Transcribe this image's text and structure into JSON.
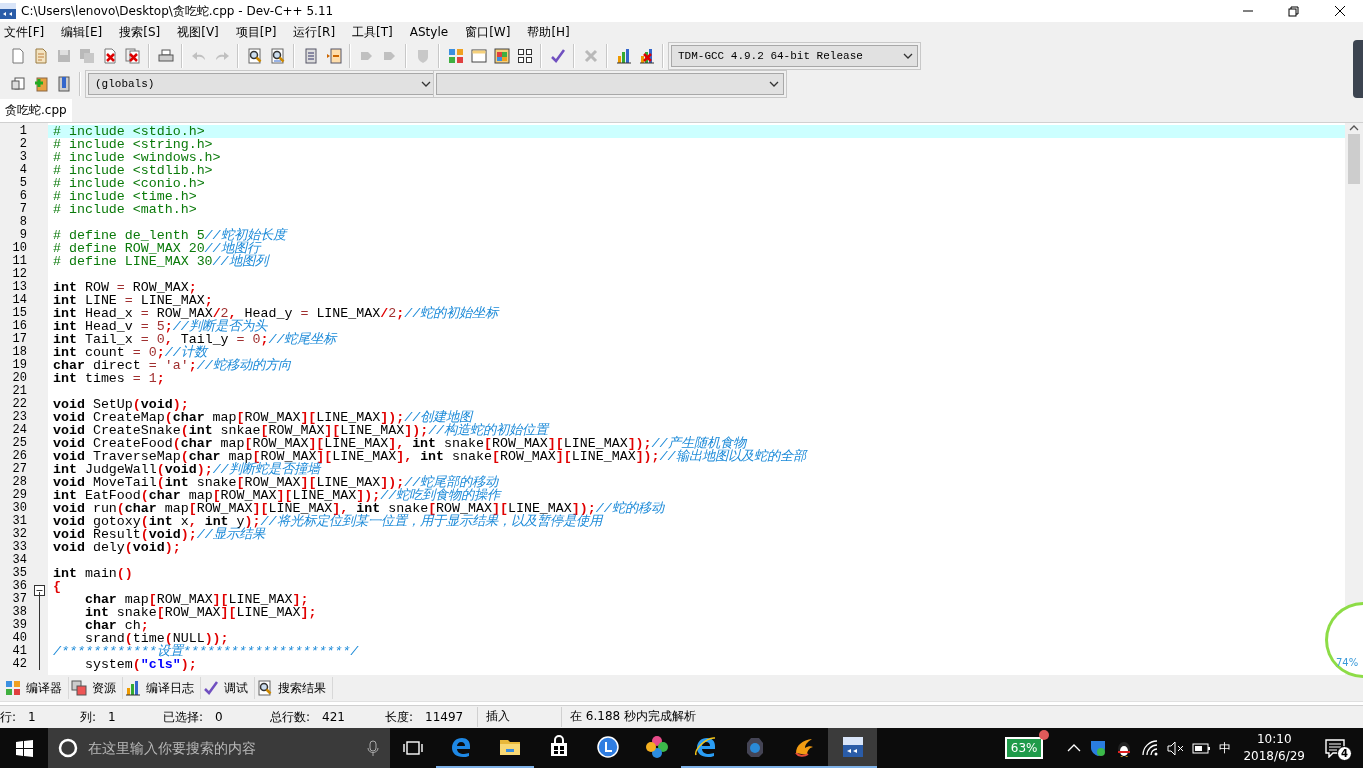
{
  "window": {
    "title": "C:\\Users\\lenovo\\Desktop\\贪吃蛇.cpp - Dev-C++ 5.11"
  },
  "menu": [
    "文件[F]",
    "编辑[E]",
    "搜索[S]",
    "视图[V]",
    "项目[P]",
    "运行[R]",
    "工具[T]",
    "AStyle",
    "窗口[W]",
    "帮助[H]"
  ],
  "toolbar": {
    "groups": [
      [
        {
          "disabled": false
        },
        {
          "disabled": false
        },
        {
          "disabled": true
        },
        {
          "disabled": true
        },
        {
          "disabled": false
        },
        {
          "disabled": false
        }
      ],
      [
        {
          "disabled": false
        }
      ],
      [
        {
          "disabled": true
        },
        {
          "disabled": true
        }
      ],
      [
        {
          "disabled": false
        },
        {
          "disabled": false
        }
      ],
      [
        {
          "disabled": false
        },
        {
          "disabled": false
        }
      ],
      [
        {
          "disabled": true
        },
        {
          "disabled": true
        }
      ],
      [
        {
          "disabled": true
        }
      ],
      [
        {
          "disabled": false
        },
        {
          "disabled": false
        },
        {
          "disabled": false
        },
        {
          "disabled": false
        }
      ],
      [
        {
          "disabled": false
        }
      ],
      [
        {
          "disabled": true
        }
      ],
      [
        {
          "disabled": false
        },
        {
          "disabled": false
        }
      ]
    ],
    "compiler": "TDM-GCC 4.9.2 64-bit Release"
  },
  "toolbar_2": {
    "buttons": [
      {
        "disabled": false
      },
      {
        "disabled": false
      },
      {
        "disabled": false
      }
    ],
    "scope": "(globals)"
  },
  "file_tabs": [
    {
      "label": "贪吃蛇.cpp",
      "selected": true
    }
  ],
  "editor": {
    "lines": [
      {
        "number": "1",
        "current": true,
        "tokens": [
          {
            "kind": "pp",
            "text": "# include <stdio.h>"
          }
        ]
      },
      {
        "number": "2",
        "current": false,
        "tokens": [
          {
            "kind": "pp",
            "text": "# include <string.h>"
          }
        ]
      },
      {
        "number": "3",
        "current": false,
        "tokens": [
          {
            "kind": "pp",
            "text": "# include <windows.h>"
          }
        ]
      },
      {
        "number": "4",
        "current": false,
        "tokens": [
          {
            "kind": "pp",
            "text": "# include <stdlib.h>"
          }
        ]
      },
      {
        "number": "5",
        "current": false,
        "tokens": [
          {
            "kind": "pp",
            "text": "# include <conio.h>"
          }
        ]
      },
      {
        "number": "6",
        "current": false,
        "tokens": [
          {
            "kind": "pp",
            "text": "# include <time.h>"
          }
        ]
      },
      {
        "number": "7",
        "current": false,
        "tokens": [
          {
            "kind": "pp",
            "text": "# include <math.h>"
          }
        ]
      },
      {
        "number": "8",
        "current": false
      },
      {
        "number": "9",
        "current": false,
        "tokens": [
          {
            "kind": "pp",
            "text": "# define de_lenth 5"
          },
          {
            "kind": "cmt",
            "text": "//蛇初始长度"
          }
        ]
      },
      {
        "number": "10",
        "current": false,
        "tokens": [
          {
            "kind": "pp",
            "text": "# define ROW_MAX 20"
          },
          {
            "kind": "cmt",
            "text": "//地图行"
          }
        ]
      },
      {
        "number": "11",
        "current": false,
        "tokens": [
          {
            "kind": "pp",
            "text": "# define LINE_MAX 30"
          },
          {
            "kind": "cmt",
            "text": "//地图列"
          }
        ]
      },
      {
        "number": "12",
        "current": false
      },
      {
        "number": "13",
        "current": false,
        "tokens": [
          {
            "kind": "kw",
            "text": "int"
          },
          {
            "kind": "id",
            "text": " ROW "
          },
          {
            "kind": "op",
            "text": "="
          },
          {
            "kind": "id",
            "text": " ROW_MAX"
          },
          {
            "kind": "sym",
            "text": ";"
          }
        ]
      },
      {
        "number": "14",
        "current": false,
        "tokens": [
          {
            "kind": "kw",
            "text": "int"
          },
          {
            "kind": "id",
            "text": " LINE "
          },
          {
            "kind": "op",
            "text": "="
          },
          {
            "kind": "id",
            "text": " LINE_MAX"
          },
          {
            "kind": "sym",
            "text": ";"
          }
        ]
      },
      {
        "number": "15",
        "current": false,
        "tokens": [
          {
            "kind": "kw",
            "text": "int"
          },
          {
            "kind": "id",
            "text": " Head_x "
          },
          {
            "kind": "op",
            "text": "="
          },
          {
            "kind": "id",
            "text": " ROW_MAX"
          },
          {
            "kind": "sym",
            "text": "/"
          },
          {
            "kind": "num",
            "text": "2"
          },
          {
            "kind": "sym",
            "text": ","
          },
          {
            "kind": "id",
            "text": " Head_y "
          },
          {
            "kind": "op",
            "text": "="
          },
          {
            "kind": "id",
            "text": " LINE_MAX"
          },
          {
            "kind": "sym",
            "text": "/"
          },
          {
            "kind": "num",
            "text": "2"
          },
          {
            "kind": "sym",
            "text": ";"
          },
          {
            "kind": "cmt",
            "text": "//蛇的初始坐标"
          }
        ]
      },
      {
        "number": "16",
        "current": false,
        "tokens": [
          {
            "kind": "kw",
            "text": "int"
          },
          {
            "kind": "id",
            "text": " Head_v "
          },
          {
            "kind": "op",
            "text": "="
          },
          {
            "kind": "num",
            "text": " 5"
          },
          {
            "kind": "sym",
            "text": ";"
          },
          {
            "kind": "cmt",
            "text": "//判断是否为头"
          }
        ]
      },
      {
        "number": "17",
        "current": false,
        "tokens": [
          {
            "kind": "kw",
            "text": "int"
          },
          {
            "kind": "id",
            "text": " Tail_x "
          },
          {
            "kind": "op",
            "text": "="
          },
          {
            "kind": "num",
            "text": " 0"
          },
          {
            "kind": "sym",
            "text": ","
          },
          {
            "kind": "id",
            "text": " Tail_y "
          },
          {
            "kind": "op",
            "text": "="
          },
          {
            "kind": "num",
            "text": " 0"
          },
          {
            "kind": "sym",
            "text": ";"
          },
          {
            "kind": "cmt",
            "text": "//蛇尾坐标"
          }
        ]
      },
      {
        "number": "18",
        "current": false,
        "tokens": [
          {
            "kind": "kw",
            "text": "int"
          },
          {
            "kind": "id",
            "text": " count "
          },
          {
            "kind": "op",
            "text": "="
          },
          {
            "kind": "num",
            "text": " 0"
          },
          {
            "kind": "sym",
            "text": ";"
          },
          {
            "kind": "cmt",
            "text": "//计数"
          }
        ]
      },
      {
        "number": "19",
        "current": false,
        "tokens": [
          {
            "kind": "kw",
            "text": "char"
          },
          {
            "kind": "id",
            "text": " direct "
          },
          {
            "kind": "op",
            "text": "="
          },
          {
            "kind": "num",
            "text": " 'a'"
          },
          {
            "kind": "sym",
            "text": ";"
          },
          {
            "kind": "cmt",
            "text": "//蛇移动的方向"
          }
        ]
      },
      {
        "number": "20",
        "current": false,
        "tokens": [
          {
            "kind": "kw",
            "text": "int"
          },
          {
            "kind": "id",
            "text": " times "
          },
          {
            "kind": "op",
            "text": "="
          },
          {
            "kind": "num",
            "text": " 1"
          },
          {
            "kind": "sym",
            "text": ";"
          }
        ]
      },
      {
        "number": "21",
        "current": false
      },
      {
        "number": "22",
        "current": false,
        "tokens": [
          {
            "kind": "kw",
            "text": "void"
          },
          {
            "kind": "id",
            "text": " SetUp"
          },
          {
            "kind": "sym",
            "text": "("
          },
          {
            "kind": "kw",
            "text": "void"
          },
          {
            "kind": "sym",
            "text": ");"
          }
        ]
      },
      {
        "number": "23",
        "current": false,
        "tokens": [
          {
            "kind": "kw",
            "text": "void"
          },
          {
            "kind": "id",
            "text": " CreateMap"
          },
          {
            "kind": "sym",
            "text": "("
          },
          {
            "kind": "kw",
            "text": "char"
          },
          {
            "kind": "id",
            "text": " map"
          },
          {
            "kind": "sym",
            "text": "["
          },
          {
            "kind": "id",
            "text": "ROW_MAX"
          },
          {
            "kind": "sym",
            "text": "]["
          },
          {
            "kind": "id",
            "text": "LINE_MAX"
          },
          {
            "kind": "sym",
            "text": "]);"
          },
          {
            "kind": "cmt",
            "text": "//创建地图"
          }
        ]
      },
      {
        "number": "24",
        "current": false,
        "tokens": [
          {
            "kind": "kw",
            "text": "void"
          },
          {
            "kind": "id",
            "text": " CreateSnake"
          },
          {
            "kind": "sym",
            "text": "("
          },
          {
            "kind": "kw",
            "text": "int"
          },
          {
            "kind": "id",
            "text": " snkae"
          },
          {
            "kind": "sym",
            "text": "["
          },
          {
            "kind": "id",
            "text": "ROW_MAX"
          },
          {
            "kind": "sym",
            "text": "]["
          },
          {
            "kind": "id",
            "text": "LINE_MAX"
          },
          {
            "kind": "sym",
            "text": "]);"
          },
          {
            "kind": "cmt",
            "text": "//构造蛇的初始位置"
          }
        ]
      },
      {
        "number": "25",
        "current": false,
        "tokens": [
          {
            "kind": "kw",
            "text": "void"
          },
          {
            "kind": "id",
            "text": " CreateFood"
          },
          {
            "kind": "sym",
            "text": "("
          },
          {
            "kind": "kw",
            "text": "char"
          },
          {
            "kind": "id",
            "text": " map"
          },
          {
            "kind": "sym",
            "text": "["
          },
          {
            "kind": "id",
            "text": "ROW_MAX"
          },
          {
            "kind": "sym",
            "text": "]["
          },
          {
            "kind": "id",
            "text": "LINE_MAX"
          },
          {
            "kind": "sym",
            "text": "], "
          },
          {
            "kind": "kw",
            "text": "int"
          },
          {
            "kind": "id",
            "text": " snake"
          },
          {
            "kind": "sym",
            "text": "["
          },
          {
            "kind": "id",
            "text": "ROW_MAX"
          },
          {
            "kind": "sym",
            "text": "]["
          },
          {
            "kind": "id",
            "text": "LINE_MAX"
          },
          {
            "kind": "sym",
            "text": "]);"
          },
          {
            "kind": "cmt",
            "text": "//产生随机食物"
          }
        ]
      },
      {
        "number": "26",
        "current": false,
        "tokens": [
          {
            "kind": "kw",
            "text": "void"
          },
          {
            "kind": "id",
            "text": " TraverseMap"
          },
          {
            "kind": "sym",
            "text": "("
          },
          {
            "kind": "kw",
            "text": "char"
          },
          {
            "kind": "id",
            "text": " map"
          },
          {
            "kind": "sym",
            "text": "["
          },
          {
            "kind": "id",
            "text": "ROW_MAX"
          },
          {
            "kind": "sym",
            "text": "]["
          },
          {
            "kind": "id",
            "text": "LINE_MAX"
          },
          {
            "kind": "sym",
            "text": "], "
          },
          {
            "kind": "kw",
            "text": "int"
          },
          {
            "kind": "id",
            "text": " snake"
          },
          {
            "kind": "sym",
            "text": "["
          },
          {
            "kind": "id",
            "text": "ROW_MAX"
          },
          {
            "kind": "sym",
            "text": "]["
          },
          {
            "kind": "id",
            "text": "LINE_MAX"
          },
          {
            "kind": "sym",
            "text": "]);"
          },
          {
            "kind": "cmt",
            "text": "//输出地图以及蛇的全部"
          }
        ]
      },
      {
        "number": "27",
        "current": false,
        "tokens": [
          {
            "kind": "kw",
            "text": "int"
          },
          {
            "kind": "id",
            "text": " JudgeWall"
          },
          {
            "kind": "sym",
            "text": "("
          },
          {
            "kind": "kw",
            "text": "void"
          },
          {
            "kind": "sym",
            "text": ");"
          },
          {
            "kind": "cmt",
            "text": "//判断蛇是否撞墙"
          }
        ]
      },
      {
        "number": "28",
        "current": false,
        "tokens": [
          {
            "kind": "kw",
            "text": "void"
          },
          {
            "kind": "id",
            "text": " MoveTail"
          },
          {
            "kind": "sym",
            "text": "("
          },
          {
            "kind": "kw",
            "text": "int"
          },
          {
            "kind": "id",
            "text": " snake"
          },
          {
            "kind": "sym",
            "text": "["
          },
          {
            "kind": "id",
            "text": "ROW_MAX"
          },
          {
            "kind": "sym",
            "text": "]["
          },
          {
            "kind": "id",
            "text": "LINE_MAX"
          },
          {
            "kind": "sym",
            "text": "]);"
          },
          {
            "kind": "cmt",
            "text": "//蛇尾部的移动"
          }
        ]
      },
      {
        "number": "29",
        "current": false,
        "tokens": [
          {
            "kind": "kw",
            "text": "int"
          },
          {
            "kind": "id",
            "text": " EatFood"
          },
          {
            "kind": "sym",
            "text": "("
          },
          {
            "kind": "kw",
            "text": "char"
          },
          {
            "kind": "id",
            "text": " map"
          },
          {
            "kind": "sym",
            "text": "["
          },
          {
            "kind": "id",
            "text": "ROW_MAX"
          },
          {
            "kind": "sym",
            "text": "]["
          },
          {
            "kind": "id",
            "text": "LINE_MAX"
          },
          {
            "kind": "sym",
            "text": "]);"
          },
          {
            "kind": "cmt",
            "text": "//蛇吃到食物的操作"
          }
        ]
      },
      {
        "number": "30",
        "current": false,
        "tokens": [
          {
            "kind": "kw",
            "text": "void"
          },
          {
            "kind": "id",
            "text": " run"
          },
          {
            "kind": "sym",
            "text": "("
          },
          {
            "kind": "kw",
            "text": "char"
          },
          {
            "kind": "id",
            "text": " map"
          },
          {
            "kind": "sym",
            "text": "["
          },
          {
            "kind": "id",
            "text": "ROW_MAX"
          },
          {
            "kind": "sym",
            "text": "]["
          },
          {
            "kind": "id",
            "text": "LINE_MAX"
          },
          {
            "kind": "sym",
            "text": "], "
          },
          {
            "kind": "kw",
            "text": "int"
          },
          {
            "kind": "id",
            "text": " snake"
          },
          {
            "kind": "sym",
            "text": "["
          },
          {
            "kind": "id",
            "text": "ROW_MAX"
          },
          {
            "kind": "sym",
            "text": "]["
          },
          {
            "kind": "id",
            "text": "LINE_MAX"
          },
          {
            "kind": "sym",
            "text": "]);"
          },
          {
            "kind": "cmt",
            "text": "//蛇的移动"
          }
        ]
      },
      {
        "number": "31",
        "current": false,
        "tokens": [
          {
            "kind": "kw",
            "text": "void"
          },
          {
            "kind": "id",
            "text": " gotoxy"
          },
          {
            "kind": "sym",
            "text": "("
          },
          {
            "kind": "kw",
            "text": "int"
          },
          {
            "kind": "id",
            "text": " x"
          },
          {
            "kind": "sym",
            "text": ", "
          },
          {
            "kind": "kw",
            "text": "int"
          },
          {
            "kind": "id",
            "text": " y"
          },
          {
            "kind": "sym",
            "text": ");"
          },
          {
            "kind": "cmt",
            "text": "//将光标定位到某一位置，用于显示结果，以及暂停是使用"
          }
        ]
      },
      {
        "number": "32",
        "current": false,
        "tokens": [
          {
            "kind": "kw",
            "text": "void"
          },
          {
            "kind": "id",
            "text": " Result"
          },
          {
            "kind": "sym",
            "text": "("
          },
          {
            "kind": "kw",
            "text": "void"
          },
          {
            "kind": "sym",
            "text": ");"
          },
          {
            "kind": "cmt",
            "text": "//显示结果"
          }
        ]
      },
      {
        "number": "33",
        "current": false,
        "tokens": [
          {
            "kind": "kw",
            "text": "void"
          },
          {
            "kind": "id",
            "text": " dely"
          },
          {
            "kind": "sym",
            "text": "("
          },
          {
            "kind": "kw",
            "text": "void"
          },
          {
            "kind": "sym",
            "text": ");"
          }
        ]
      },
      {
        "number": "34",
        "current": false
      },
      {
        "number": "35",
        "current": false,
        "tokens": [
          {
            "kind": "kw",
            "text": "int"
          },
          {
            "kind": "id",
            "text": " main"
          },
          {
            "kind": "sym",
            "text": "()"
          }
        ]
      },
      {
        "number": "36",
        "current": false,
        "fold_start": true,
        "tokens": [
          {
            "kind": "sym",
            "text": "{"
          }
        ]
      },
      {
        "number": "37",
        "current": false,
        "tokens": [
          {
            "kind": "kw",
            "text": "    char"
          },
          {
            "kind": "id",
            "text": " map"
          },
          {
            "kind": "sym",
            "text": "["
          },
          {
            "kind": "id",
            "text": "ROW_MAX"
          },
          {
            "kind": "sym",
            "text": "]["
          },
          {
            "kind": "id",
            "text": "LINE_MAX"
          },
          {
            "kind": "sym",
            "text": "];"
          }
        ]
      },
      {
        "number": "38",
        "current": false,
        "tokens": [
          {
            "kind": "kw",
            "text": "    int"
          },
          {
            "kind": "id",
            "text": " snake"
          },
          {
            "kind": "sym",
            "text": "["
          },
          {
            "kind": "id",
            "text": "ROW_MAX"
          },
          {
            "kind": "sym",
            "text": "]["
          },
          {
            "kind": "id",
            "text": "LINE_MAX"
          },
          {
            "kind": "sym",
            "text": "];"
          }
        ]
      },
      {
        "number": "39",
        "current": false,
        "tokens": [
          {
            "kind": "kw",
            "text": "    char"
          },
          {
            "kind": "id",
            "text": " ch"
          },
          {
            "kind": "sym",
            "text": ";"
          }
        ]
      },
      {
        "number": "40",
        "current": false,
        "tokens": [
          {
            "kind": "id",
            "text": "    srand"
          },
          {
            "kind": "sym",
            "text": "("
          },
          {
            "kind": "id",
            "text": "time"
          },
          {
            "kind": "sym",
            "text": "("
          },
          {
            "kind": "id",
            "text": "NULL"
          },
          {
            "kind": "sym",
            "text": "));"
          }
        ]
      },
      {
        "number": "41",
        "current": false,
        "tokens": [
          {
            "kind": "cmt",
            "text": "/************设置*********************/"
          }
        ]
      },
      {
        "number": "42",
        "current": false,
        "tokens": [
          {
            "kind": "id",
            "text": "    system"
          },
          {
            "kind": "sym",
            "text": "("
          },
          {
            "kind": "str",
            "text": "\"cls\""
          },
          {
            "kind": "sym",
            "text": ");"
          }
        ]
      }
    ]
  },
  "bottom_tabs": [
    {
      "label": "编译器"
    },
    {
      "label": "资源"
    },
    {
      "label": "编译日志"
    },
    {
      "label": "调试"
    },
    {
      "label": "搜索结果"
    }
  ],
  "status_bar": {
    "fields": [
      {
        "label": "行:",
        "value": "1"
      },
      {
        "label": "列:",
        "value": "1"
      },
      {
        "label": "已选择:",
        "value": "0"
      },
      {
        "label": "总行数:",
        "value": "421"
      },
      {
        "label": "长度:",
        "value": "11497"
      }
    ],
    "mode": "插入",
    "message": "在 6.188 秒内完成解析"
  },
  "taskbar": {
    "search_placeholder": "在这里输入你要搜索的内容",
    "apps": [
      {
        "running": true,
        "selected": false
      },
      {
        "running": true,
        "selected": false
      },
      {
        "running": false,
        "selected": false
      },
      {
        "running": false,
        "selected": false
      },
      {
        "running": false,
        "selected": false
      },
      {
        "running": true,
        "selected": false
      },
      {
        "running": true,
        "selected": false
      },
      {
        "running": true,
        "selected": false
      },
      {
        "running": true,
        "selected": true
      }
    ],
    "battery_widget": "63%",
    "input_method": "中",
    "time": "10:10",
    "date": "2018/6/29",
    "notifications": "4"
  },
  "speed_ball": {
    "reading": "74%"
  }
}
